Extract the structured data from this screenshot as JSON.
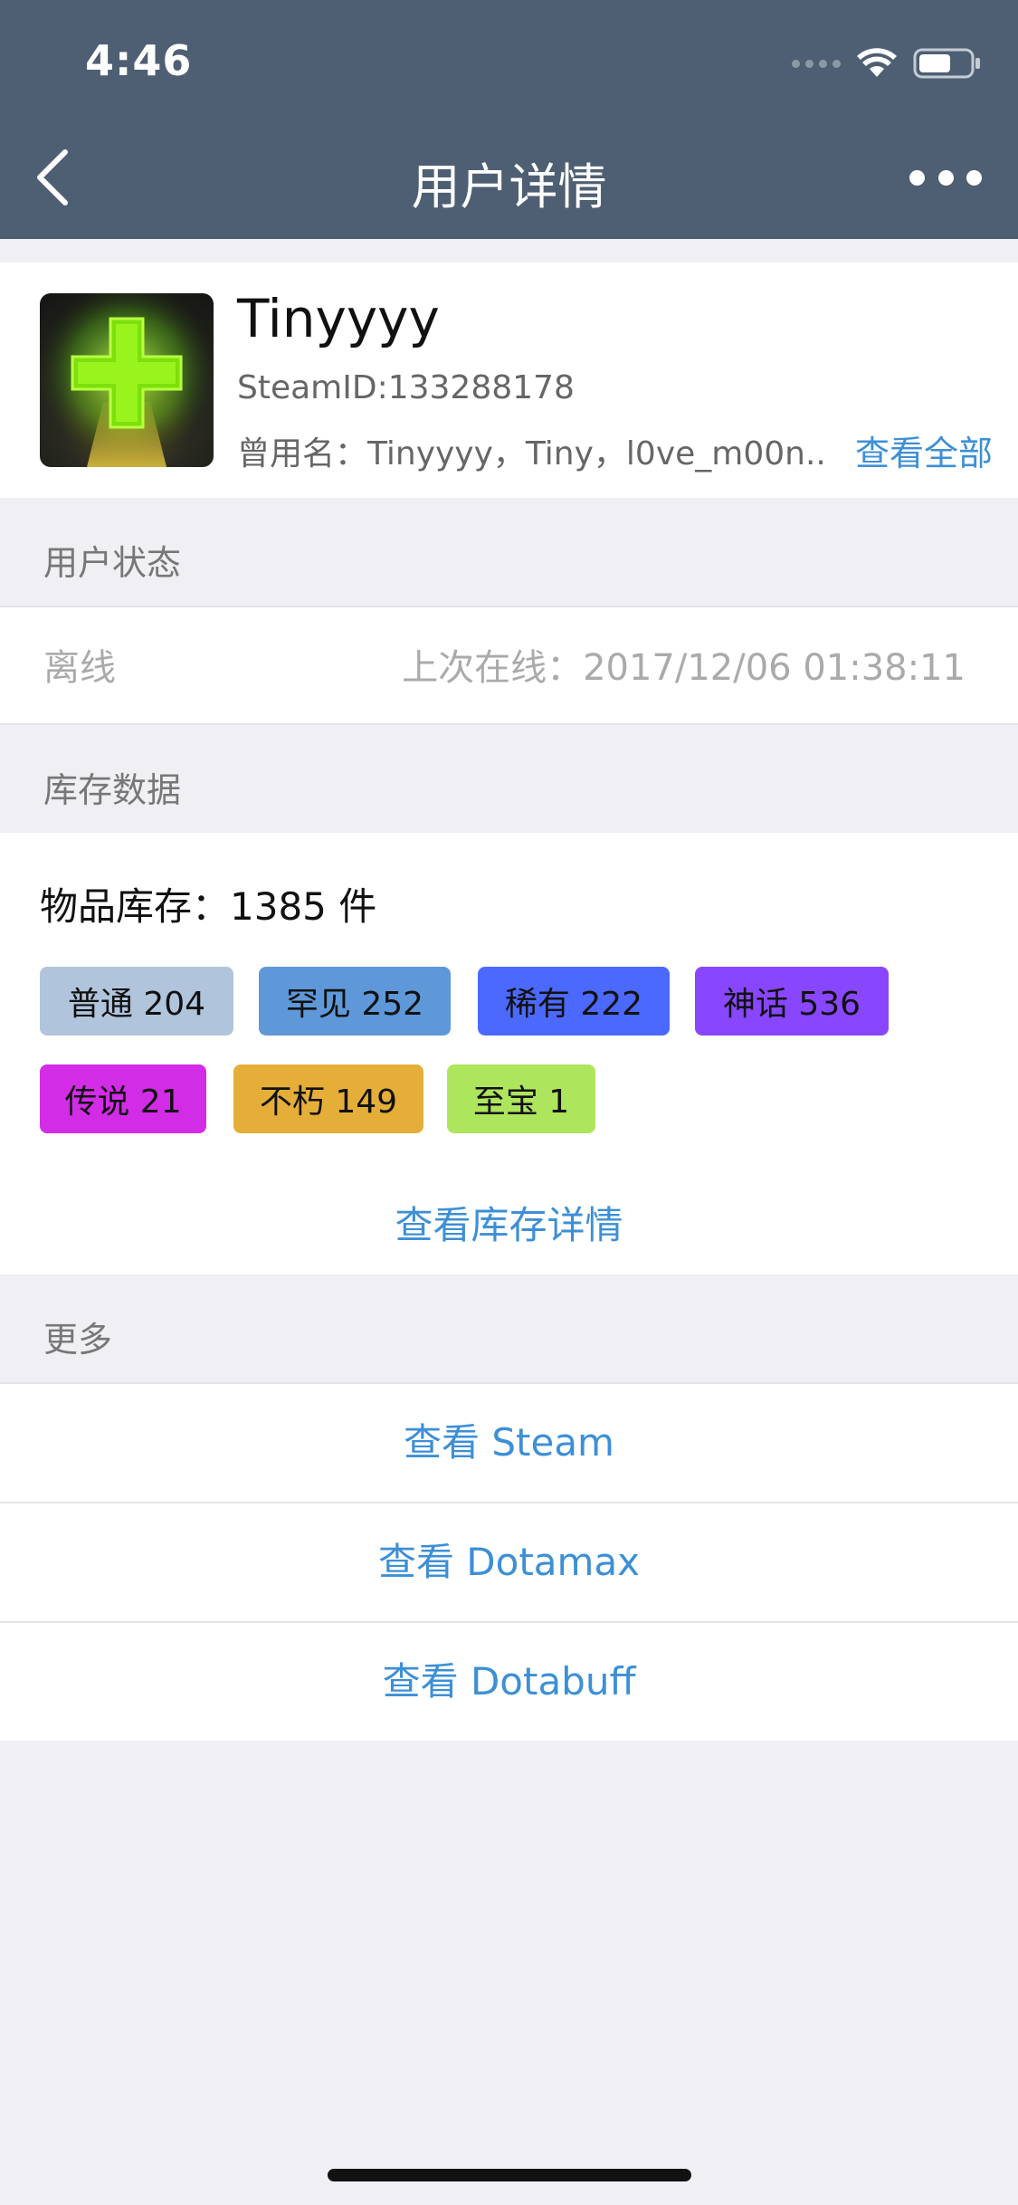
{
  "status_bar": {
    "time": "4:46"
  },
  "nav": {
    "title": "用户详情"
  },
  "profile": {
    "username": "Tinyyyy",
    "steam_id": "SteamID:133288178",
    "aliases": "曾用名：Tinyyyy，Tiny，l0ve_m00n...",
    "view_all": "查看全部"
  },
  "user_status": {
    "section_title": "用户状态",
    "state": "离线",
    "last_online": "上次在线：2017/12/06 01:38:11"
  },
  "inventory": {
    "section_title": "库存数据",
    "total": "物品库存：1385 件",
    "tags": [
      {
        "label": "普通 204",
        "color": "#b0c4dc"
      },
      {
        "label": "罕见 252",
        "color": "#5e98d9"
      },
      {
        "label": "稀有 222",
        "color": "#4b69ff"
      },
      {
        "label": "神话 536",
        "color": "#8847ff"
      },
      {
        "label": "传说 21",
        "color": "#d32ce6"
      },
      {
        "label": "不朽 149",
        "color": "#e4ae39"
      },
      {
        "label": "至宝 1",
        "color": "#ade55c"
      }
    ],
    "details_link": "查看库存详情"
  },
  "more": {
    "section_title": "更多",
    "links": [
      "查看 Steam",
      "查看 Dotamax",
      "查看 Dotabuff"
    ]
  }
}
